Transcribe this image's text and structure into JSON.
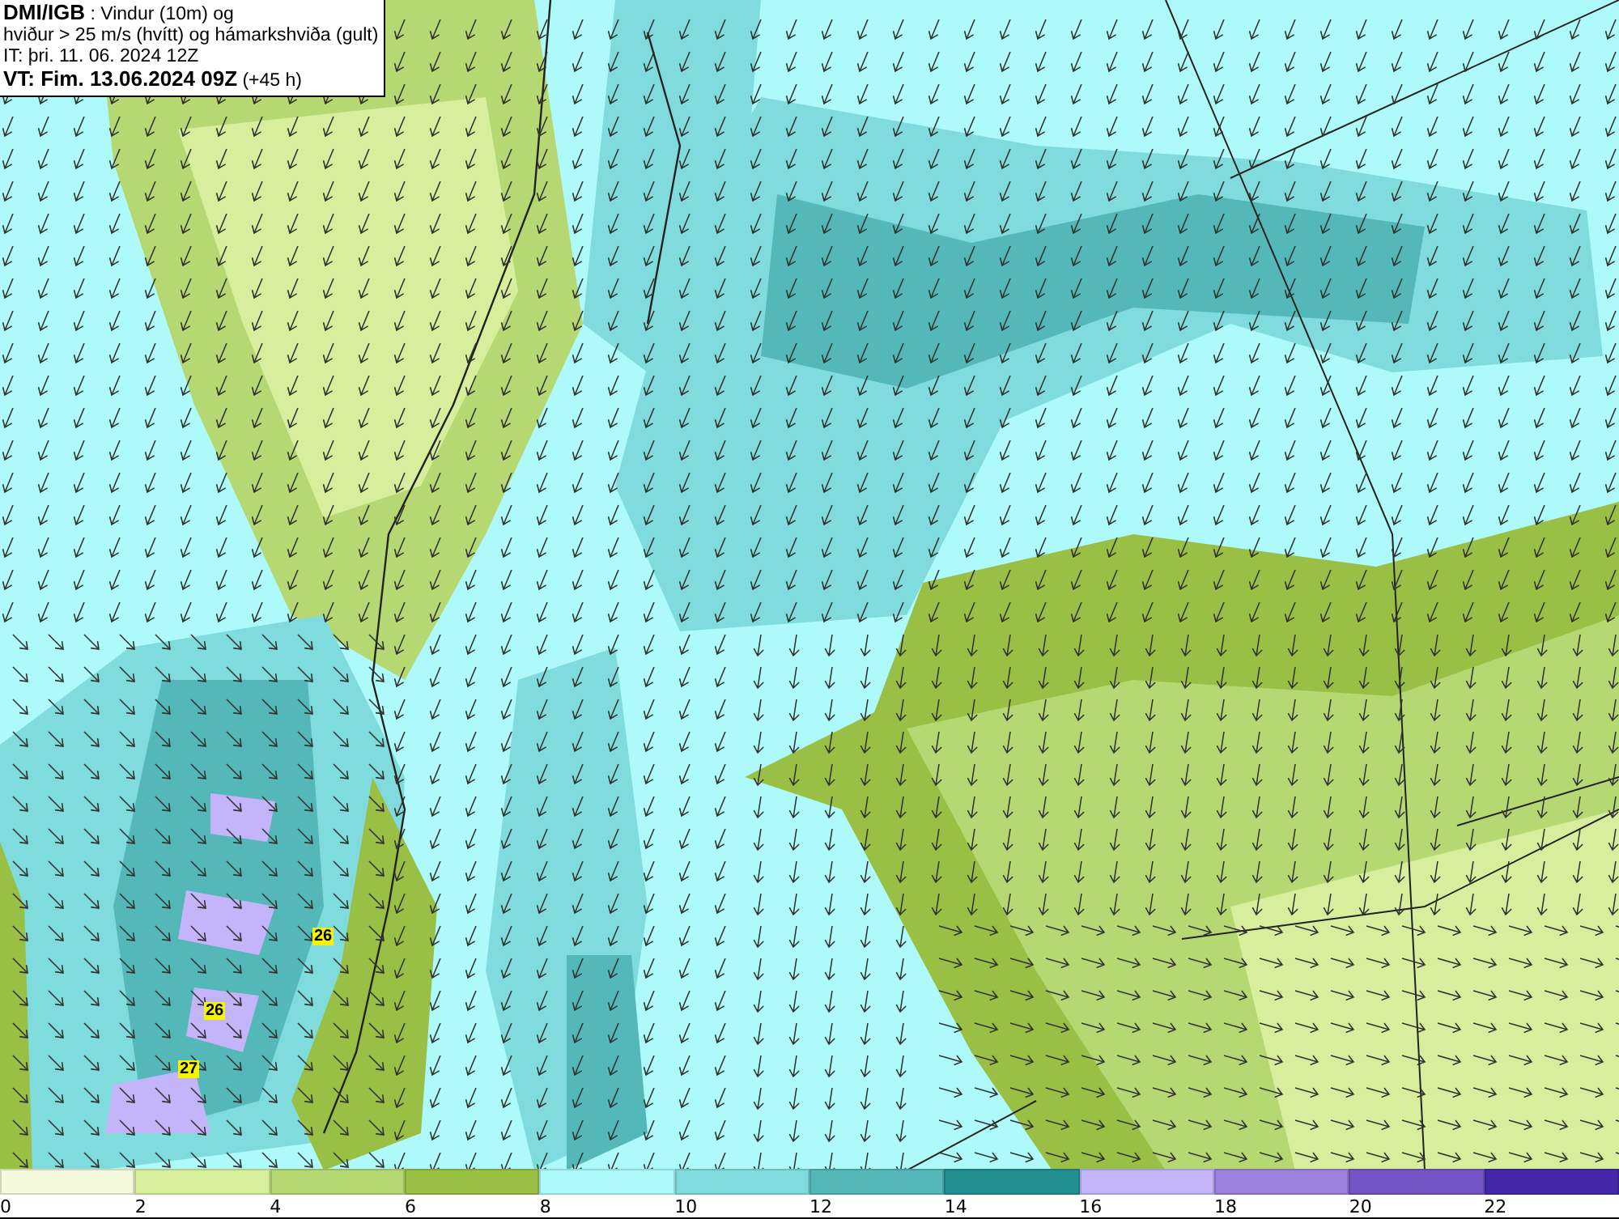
{
  "title_box": {
    "lines": [
      "**DMI/IGB** : Vindur (10m) og",
      "hviður > 25 m/s (hvítt) og hámarkshviða (gult)",
      "IT: þri. 11. 06. 2024 12Z",
      "**VT: Fim. 13.06.2024 09Z** (+45 h)"
    ]
  },
  "gust_labels": [
    {
      "value": "26"
    },
    {
      "value": "26"
    },
    {
      "value": "27"
    }
  ],
  "legend": {
    "bins": [
      {
        "label": "0",
        "color": "#f4fadb"
      },
      {
        "label": "2",
        "color": "#d7ef9c"
      },
      {
        "label": "4",
        "color": "#b6d873"
      },
      {
        "label": "6",
        "color": "#99bf45"
      },
      {
        "label": "8",
        "color": "#aefafa"
      },
      {
        "label": "10",
        "color": "#80dcdc"
      },
      {
        "label": "12",
        "color": "#55b8b8"
      },
      {
        "label": "14",
        "color": "#229090"
      },
      {
        "label": "16",
        "color": "#c4b5fb"
      },
      {
        "label": "18",
        "color": "#9a82de"
      },
      {
        "label": "20",
        "color": "#7355c5"
      },
      {
        "label": "22",
        "color": "#4228a8"
      }
    ]
  }
}
